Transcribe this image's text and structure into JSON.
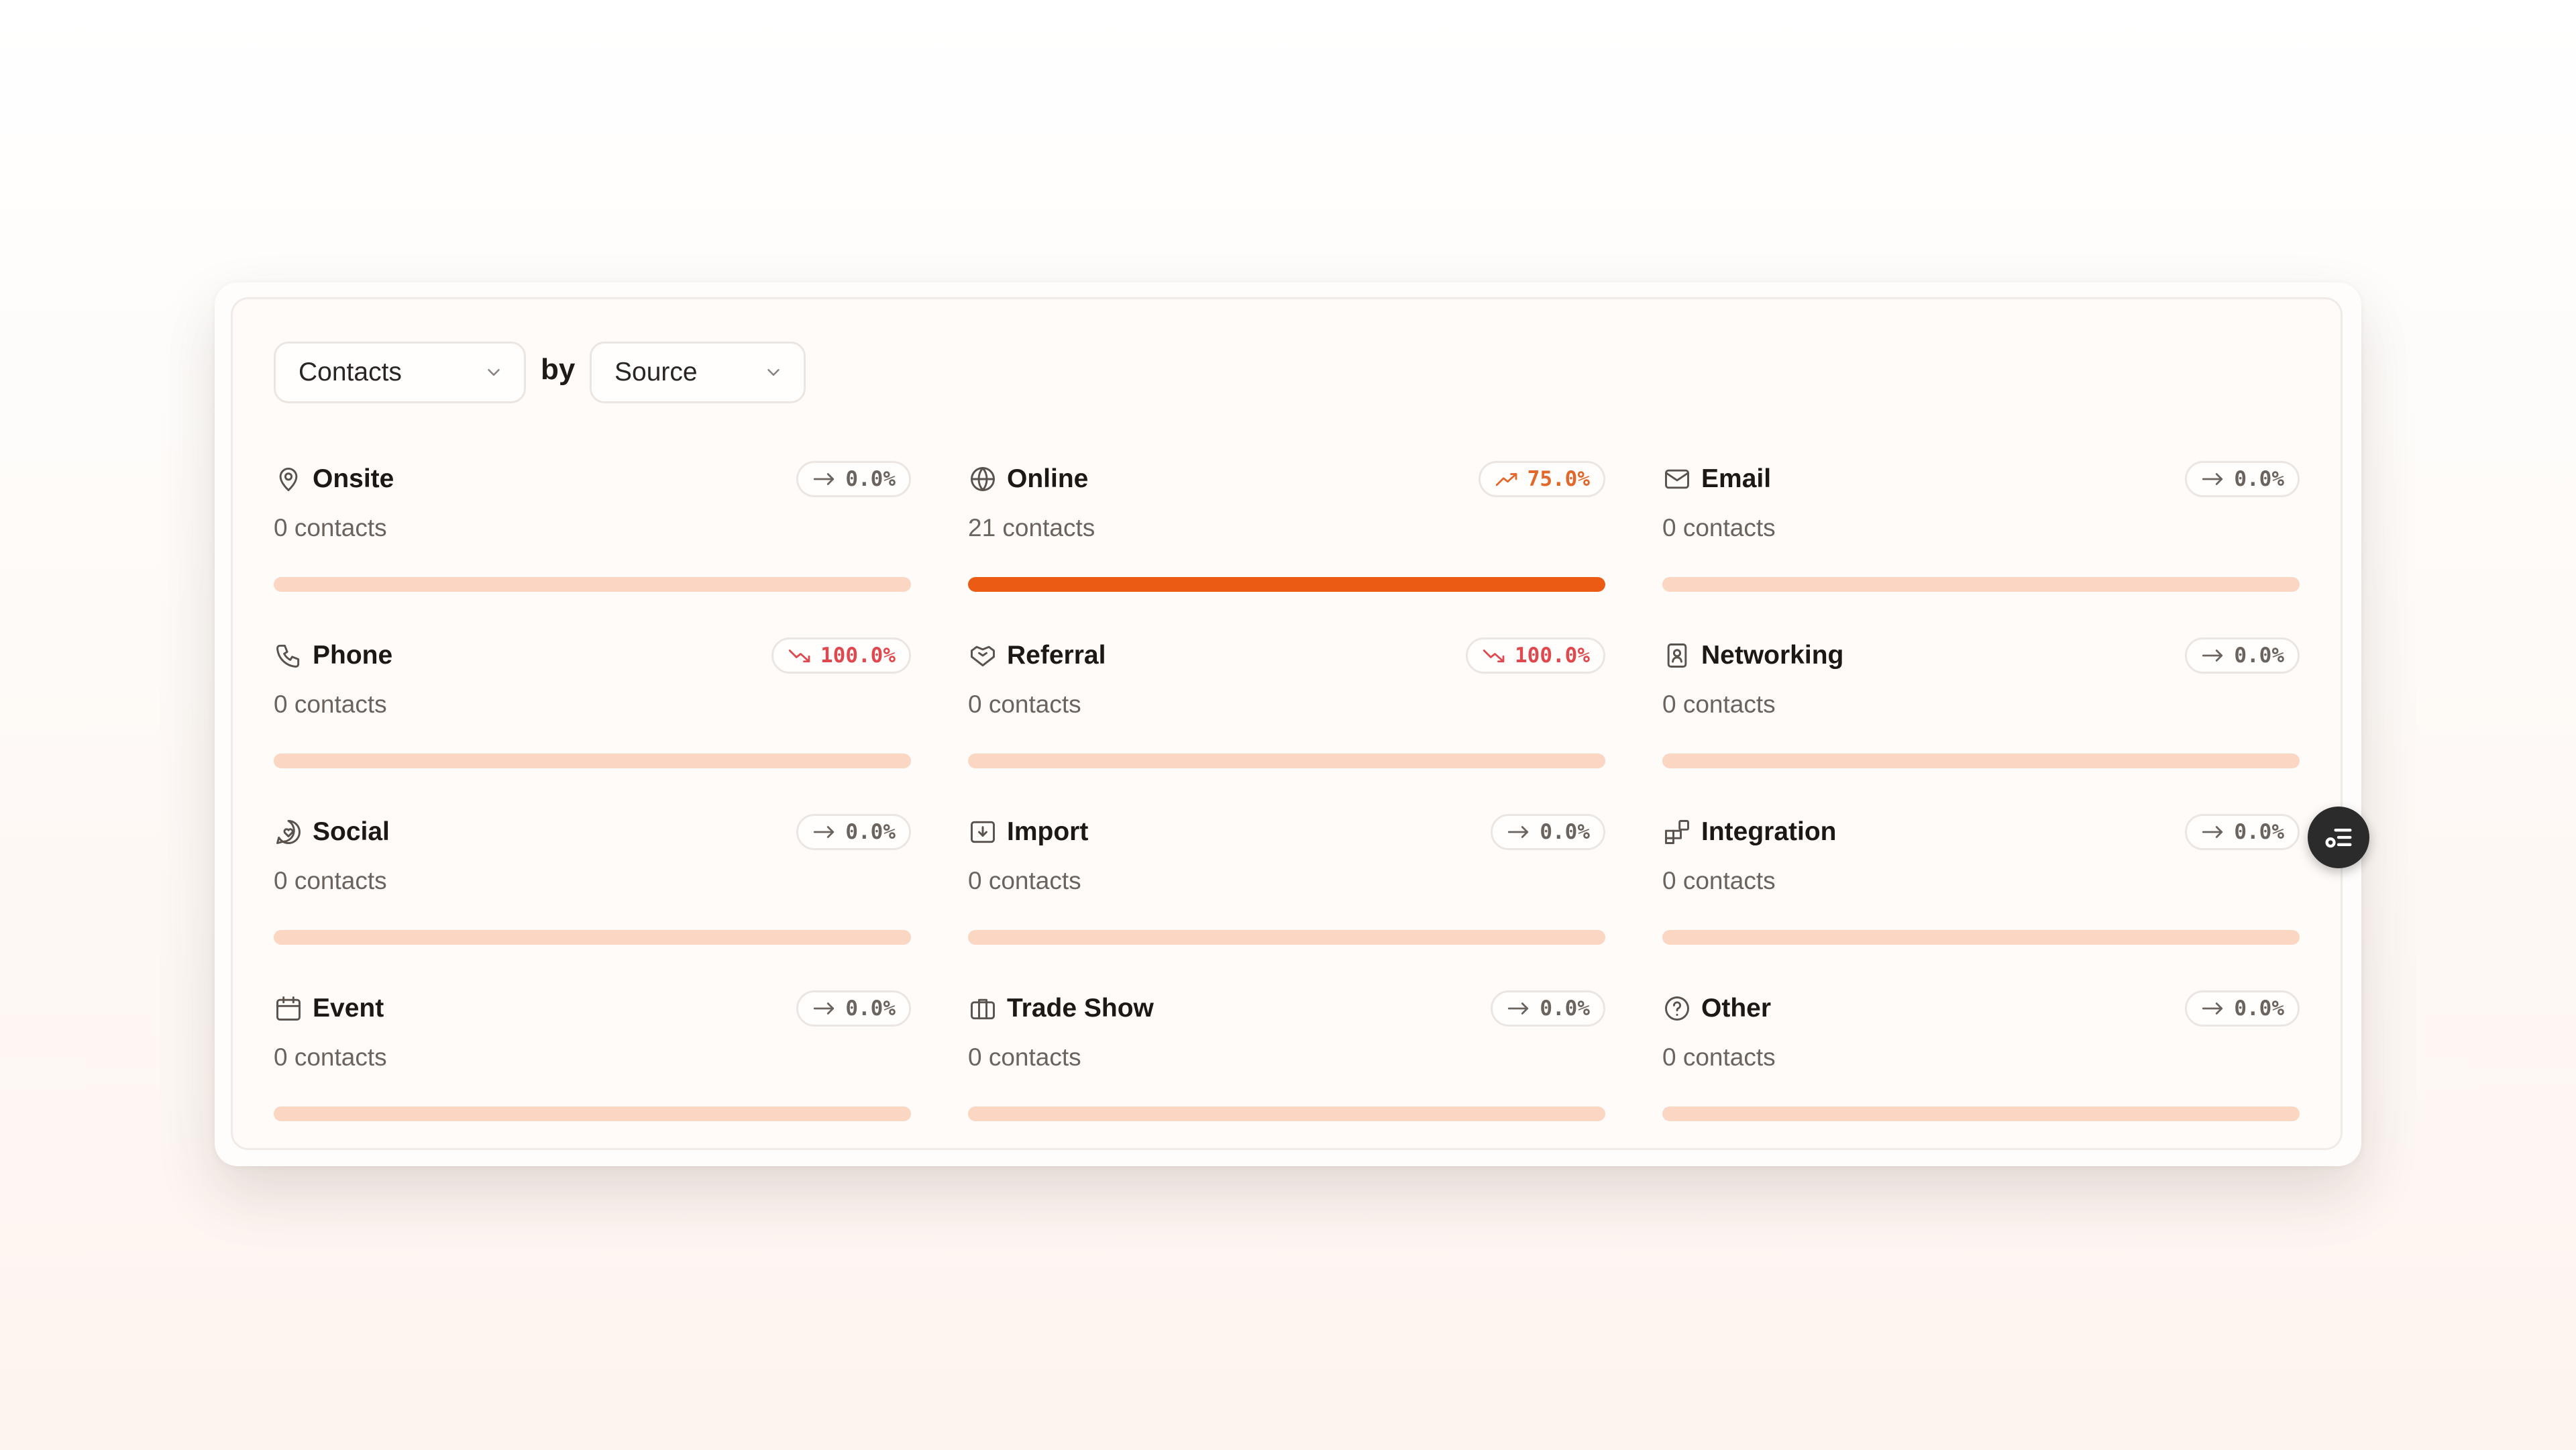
{
  "toolbar": {
    "metric_label": "Contacts",
    "by_label": "by",
    "group_label": "Source"
  },
  "colors": {
    "accent": "#ec5b13",
    "bar_track": "#fbd6c3",
    "trend_flat": "#6b635e",
    "trend_up": "#e2672a",
    "trend_down": "#e0484e"
  },
  "tiles": [
    {
      "name": "Onsite",
      "icon": "map-pin-icon",
      "count": "0 contacts",
      "trend": "0.0%",
      "direction": "flat",
      "share": 0
    },
    {
      "name": "Online",
      "icon": "globe-icon",
      "count": "21 contacts",
      "trend": "75.0%",
      "direction": "up",
      "share": 1
    },
    {
      "name": "Email",
      "icon": "mail-icon",
      "count": "0 contacts",
      "trend": "0.0%",
      "direction": "flat",
      "share": 0
    },
    {
      "name": "Phone",
      "icon": "phone-icon",
      "count": "0 contacts",
      "trend": "100.0%",
      "direction": "down",
      "share": 0
    },
    {
      "name": "Referral",
      "icon": "handshake-icon",
      "count": "0 contacts",
      "trend": "100.0%",
      "direction": "down",
      "share": 0
    },
    {
      "name": "Networking",
      "icon": "contact-book-icon",
      "count": "0 contacts",
      "trend": "0.0%",
      "direction": "flat",
      "share": 0
    },
    {
      "name": "Social",
      "icon": "chat-heart-icon",
      "count": "0 contacts",
      "trend": "0.0%",
      "direction": "flat",
      "share": 0
    },
    {
      "name": "Import",
      "icon": "import-icon",
      "count": "0 contacts",
      "trend": "0.0%",
      "direction": "flat",
      "share": 0
    },
    {
      "name": "Integration",
      "icon": "blocks-icon",
      "count": "0 contacts",
      "trend": "0.0%",
      "direction": "flat",
      "share": 0
    },
    {
      "name": "Event",
      "icon": "calendar-icon",
      "count": "0 contacts",
      "trend": "0.0%",
      "direction": "flat",
      "share": 0
    },
    {
      "name": "Trade Show",
      "icon": "briefcase-icon",
      "count": "0 contacts",
      "trend": "0.0%",
      "direction": "flat",
      "share": 0
    },
    {
      "name": "Other",
      "icon": "help-circle-icon",
      "count": "0 contacts",
      "trend": "0.0%",
      "direction": "flat",
      "share": 0
    }
  ],
  "fab": {
    "icon": "filter-settings-icon"
  }
}
